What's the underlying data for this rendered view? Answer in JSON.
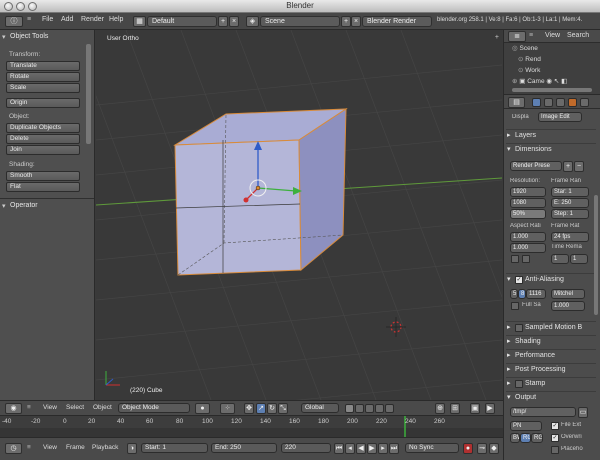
{
  "window": {
    "title": "Blender"
  },
  "infobar": {
    "menu": [
      "File",
      "Add",
      "Render",
      "Help"
    ],
    "screen_layout": "Default",
    "scene": "Scene",
    "render_engine": "Blender Render",
    "stats": "blender.org 258.1 | Ve:8 | Fa:6 | Ob:1-3 | La:1 | Mem:4."
  },
  "toolshelf": {
    "header": "Object Tools",
    "transform_label": "Transform:",
    "transform_buttons": [
      "Translate",
      "Rotate",
      "Scale"
    ],
    "origin_button": "Origin",
    "object_label": "Object:",
    "object_buttons": [
      "Duplicate Objects",
      "Delete",
      "Join"
    ],
    "shading_label": "Shading:",
    "shading_buttons": [
      "Smooth",
      "Flat"
    ],
    "operator_header": "Operator"
  },
  "viewport": {
    "view_label": "User Ortho",
    "object_label": "(220) Cube"
  },
  "outliner": {
    "view_menu": "View",
    "search_menu": "Search",
    "items": [
      "Scene",
      "Rend",
      "Work",
      "Came"
    ]
  },
  "properties": {
    "display_label": "Displa",
    "display_value": "Image Edit",
    "panels_top": [
      "Layers",
      "Dimensions"
    ],
    "render_preset": "Render Prese",
    "resolution_label": "Resolution:",
    "res_x": "1920",
    "res_y": "1080",
    "res_pct": "50%",
    "frame_range_label": "Frame Ran",
    "start": "Star: 1",
    "end": "E: 250",
    "step": "Step: 1",
    "aspect_label": "Aspect Rati",
    "aspect_x": "1.000",
    "aspect_y": "1.000",
    "frame_rate_label": "Frame Rat",
    "fps": "24 fps",
    "time_remap_label": "Time Rema",
    "remap_old": "1",
    "remap_new": "1",
    "aa_label": "Anti-Aliasing",
    "aa_samples": [
      "5",
      "8",
      "1116"
    ],
    "aa_filter": "Mitchel",
    "full_sample": "Full Sa",
    "filter_size": "1.000",
    "panels_bottom": [
      "Sampled Motion B",
      "Shading",
      "Performance",
      "Post Processing",
      "Stamp",
      "Output"
    ],
    "output_path": "/tmp/",
    "file_ext": "File Ext",
    "overwrite": "Overwri",
    "placeholder": "Placeho",
    "format": "PN",
    "color_modes": [
      "BW",
      "RG",
      "RG"
    ]
  },
  "view3d_header": {
    "menus": [
      "View",
      "Select",
      "Object"
    ],
    "mode": "Object Mode",
    "orientation": "Global"
  },
  "timeline": {
    "ticks": [
      "-40",
      "-20",
      "0",
      "20",
      "40",
      "60",
      "80",
      "100",
      "120",
      "140",
      "160",
      "180",
      "200",
      "220",
      "240",
      "260"
    ],
    "menus": [
      "View",
      "Frame",
      "Playback"
    ],
    "start": "Start: 1",
    "end": "End: 250",
    "current": "220",
    "sync": "No Sync"
  }
}
